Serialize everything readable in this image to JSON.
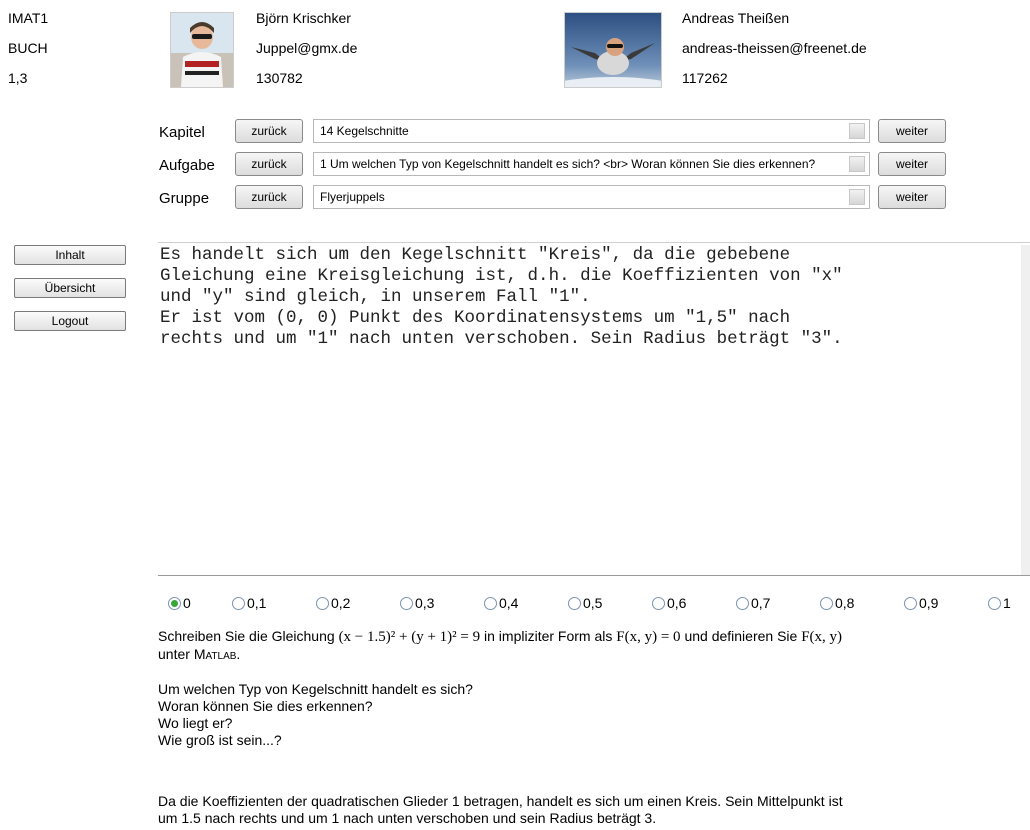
{
  "header": {
    "course": "IMAT1",
    "book": "BUCH",
    "version": "1,3",
    "students": [
      {
        "name": "Björn Krischker",
        "email": "Juppel@gmx.de",
        "id": "130782"
      },
      {
        "name": "Andreas Theißen",
        "email": "andreas-theissen@freenet.de",
        "id": "117262"
      }
    ]
  },
  "nav": {
    "back_label": "zurück",
    "next_label": "weiter",
    "rows": [
      {
        "label": "Kapitel",
        "value": "14 Kegelschnitte"
      },
      {
        "label": "Aufgabe",
        "value": "1 Um welchen Typ von Kegelschnitt handelt es sich? <br> Woran können Sie dies erkennen?"
      },
      {
        "label": "Gruppe",
        "value": "Flyerjuppels"
      }
    ]
  },
  "sidebar": {
    "items": [
      {
        "label": "Inhalt"
      },
      {
        "label": "Übersicht"
      },
      {
        "label": "Logout"
      }
    ]
  },
  "answer": {
    "text": "Es handelt sich um den Kegelschnitt \"Kreis\", da die gebebene\nGleichung eine Kreisgleichung ist, d.h. die Koeffizienten von \"x\"\nund \"y\" sind gleich, in unserem Fall \"1\".\nEr ist vom (0, 0) Punkt des Koordinatensystems um \"1,5\" nach\nrechts und um \"1\" nach unten verschoben. Sein Radius beträgt \"3\"."
  },
  "grading": {
    "selected": "0",
    "options": [
      "0",
      "0,1",
      "0,2",
      "0,3",
      "0,4",
      "0,5",
      "0,6",
      "0,7",
      "0,8",
      "0,9",
      "1"
    ]
  },
  "task": {
    "intro_before": "Schreiben Sie die Gleichung",
    "equation": "(x − 1.5)² + (y + 1)² = 9",
    "intro_middle": "in impliziter Form als",
    "implicit_form": "F(x, y) = 0",
    "intro_after": "und definieren Sie",
    "function_name": "F(x, y)",
    "intro_end": "unter",
    "matlab": "Matlab",
    "period": ".",
    "questions": [
      "Um welchen Typ von Kegelschnitt handelt es sich?",
      "Woran können Sie dies erkennen?",
      "Wo liegt er?",
      "Wie groß ist sein...?"
    ],
    "solution_line1": "Da die Koeffizienten der quadratischen Glieder 1 betragen, handelt es sich um einen Kreis. Sein Mittelpunkt ist",
    "solution_line2": "um 1.5 nach rechts und um 1 nach unten verschoben und sein Radius beträgt 3."
  }
}
